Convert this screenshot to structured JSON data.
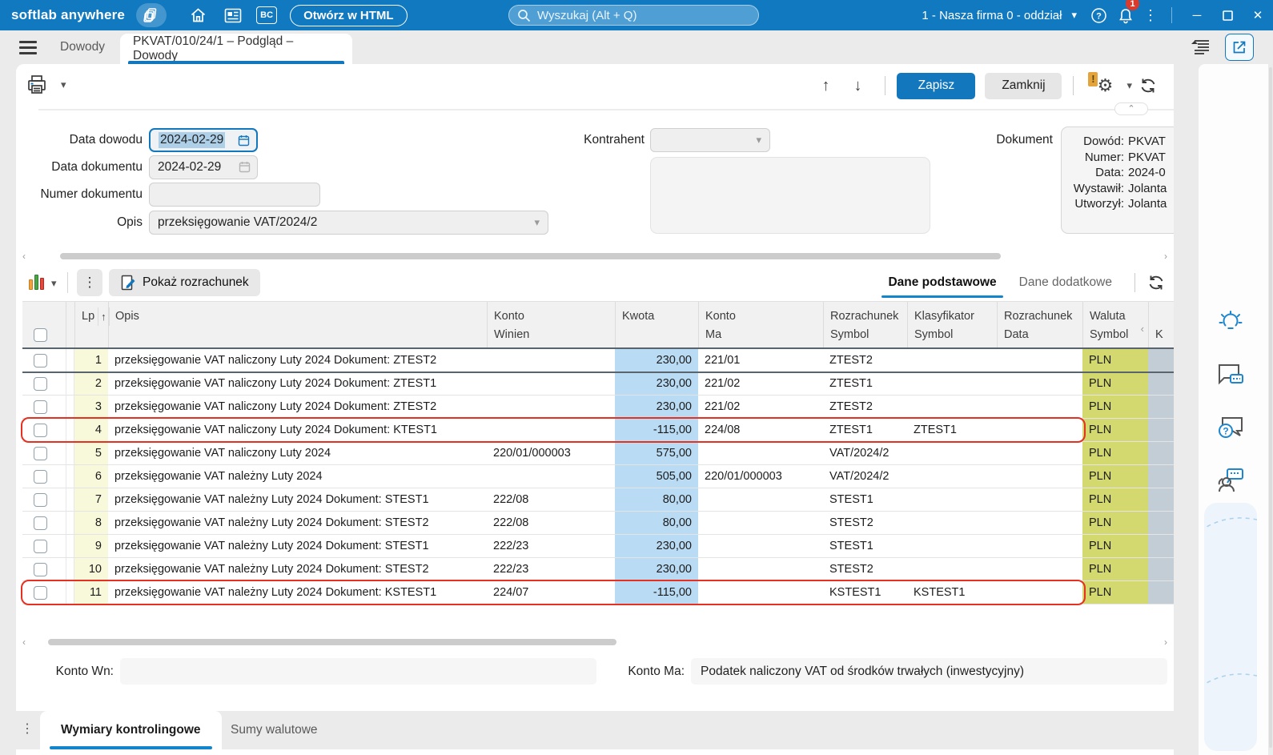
{
  "colors": {
    "topbar_blue": "#1079c0",
    "accent_blue": "#1377bd",
    "badge_red": "#d93a2b",
    "annotation_red": "#e53022",
    "kwota_column_bg": "#b9dbf4",
    "lp_column_bg": "#f8f8da",
    "waluta_column_bg": "#d3d96e"
  },
  "topbar": {
    "app_name": "softlab anywhere",
    "bc_label": "BC",
    "open_html_label": "Otwórz w HTML",
    "search_placeholder": "Wyszukaj (Alt + Q)",
    "company": "1 - Nasza firma 0 - oddział",
    "bell_badge": "1"
  },
  "tabs": {
    "dowody": "Dowody",
    "active": "PKVAT/010/24/1 – Podgląd – Dowody"
  },
  "toolbar": {
    "save": "Zapisz",
    "close": "Zamknij"
  },
  "form": {
    "data_dowodu_label": "Data dowodu",
    "data_dowodu_value": "2024-02-29",
    "data_dokumentu_label": "Data dokumentu",
    "data_dokumentu_value": "2024-02-29",
    "numer_dokumentu_label": "Numer dokumentu",
    "numer_dokumentu_value": "",
    "opis_label": "Opis",
    "opis_value": "przeksięgowanie  VAT/2024/2",
    "kontrahent_label": "Kontrahent",
    "kontrahent_value": "",
    "dokument_label": "Dokument",
    "dokument_lines": [
      {
        "label": "Dowód:",
        "value": "PKVAT"
      },
      {
        "label": "Numer:",
        "value": "PKVAT"
      },
      {
        "label": "Data:",
        "value": "2024-0"
      },
      {
        "label": "Wystawił:",
        "value": "Jolanta"
      },
      {
        "label": "Utworzył:",
        "value": "Jolanta"
      }
    ]
  },
  "grid_toolbar": {
    "pokaz_rozrachunek": "Pokaż rozrachunek",
    "tab_dane_podstawowe": "Dane podstawowe",
    "tab_dane_dodatkowe": "Dane dodatkowe"
  },
  "table": {
    "headers": {
      "lp": "Lp",
      "sort_arrow": "↑",
      "opis": "Opis",
      "konto": "Konto",
      "winien": "Winien",
      "kwota": "Kwota",
      "ma": "Ma",
      "rozrachunek": "Rozrachunek",
      "symbol": "Symbol",
      "klasyfikator": "Klasyfikator",
      "data": "Data",
      "waluta": "Waluta",
      "k": "K"
    },
    "rows": [
      {
        "lp": "1",
        "opis": "przeksięgowanie VAT naliczony Luty 2024 Dokument: ZTEST2",
        "konto_winien": "",
        "kwota": "230,00",
        "konto_ma": "221/01",
        "rozrachunek_symbol": "ZTEST2",
        "klasyfikator_symbol": "",
        "rozrachunek_data": "",
        "waluta": "PLN",
        "selected": true
      },
      {
        "lp": "2",
        "opis": "przeksięgowanie VAT naliczony Luty 2024 Dokument: ZTEST1",
        "konto_winien": "",
        "kwota": "230,00",
        "konto_ma": "221/02",
        "rozrachunek_symbol": "ZTEST1",
        "klasyfikator_symbol": "",
        "rozrachunek_data": "",
        "waluta": "PLN"
      },
      {
        "lp": "3",
        "opis": "przeksięgowanie VAT naliczony Luty 2024 Dokument: ZTEST2",
        "konto_winien": "",
        "kwota": "230,00",
        "konto_ma": "221/02",
        "rozrachunek_symbol": "ZTEST2",
        "klasyfikator_symbol": "",
        "rozrachunek_data": "",
        "waluta": "PLN"
      },
      {
        "lp": "4",
        "opis": "przeksięgowanie VAT naliczony Luty 2024 Dokument: KTEST1",
        "konto_winien": "",
        "kwota": "-115,00",
        "konto_ma": "224/08",
        "rozrachunek_symbol": "ZTEST1",
        "klasyfikator_symbol": "ZTEST1",
        "rozrachunek_data": "",
        "waluta": "PLN",
        "red_outline": true
      },
      {
        "lp": "5",
        "opis": "przeksięgowanie VAT naliczony Luty 2024",
        "konto_winien": "220/01/000003",
        "kwota": "575,00",
        "konto_ma": "",
        "rozrachunek_symbol": "VAT/2024/2",
        "klasyfikator_symbol": "",
        "rozrachunek_data": "",
        "waluta": "PLN"
      },
      {
        "lp": "6",
        "opis": "przeksięgowanie VAT należny Luty 2024",
        "konto_winien": "",
        "kwota": "505,00",
        "konto_ma": "220/01/000003",
        "rozrachunek_symbol": "VAT/2024/2",
        "klasyfikator_symbol": "",
        "rozrachunek_data": "",
        "waluta": "PLN"
      },
      {
        "lp": "7",
        "opis": "przeksięgowanie VAT należny Luty 2024 Dokument: STEST1",
        "konto_winien": "222/08",
        "kwota": "80,00",
        "konto_ma": "",
        "rozrachunek_symbol": "STEST1",
        "klasyfikator_symbol": "",
        "rozrachunek_data": "",
        "waluta": "PLN"
      },
      {
        "lp": "8",
        "opis": "przeksięgowanie VAT należny Luty 2024 Dokument: STEST2",
        "konto_winien": "222/08",
        "kwota": "80,00",
        "konto_ma": "",
        "rozrachunek_symbol": "STEST2",
        "klasyfikator_symbol": "",
        "rozrachunek_data": "",
        "waluta": "PLN"
      },
      {
        "lp": "9",
        "opis": "przeksięgowanie VAT należny Luty 2024 Dokument: STEST1",
        "konto_winien": "222/23",
        "kwota": "230,00",
        "konto_ma": "",
        "rozrachunek_symbol": "STEST1",
        "klasyfikator_symbol": "",
        "rozrachunek_data": "",
        "waluta": "PLN"
      },
      {
        "lp": "10",
        "opis": "przeksięgowanie VAT należny Luty 2024 Dokument: STEST2",
        "konto_winien": "222/23",
        "kwota": "230,00",
        "konto_ma": "",
        "rozrachunek_symbol": "STEST2",
        "klasyfikator_symbol": "",
        "rozrachunek_data": "",
        "waluta": "PLN"
      },
      {
        "lp": "11",
        "opis": "przeksięgowanie VAT należny Luty 2024 Dokument: KSTEST1",
        "konto_winien": "224/07",
        "kwota": "-115,00",
        "konto_ma": "",
        "rozrachunek_symbol": "KSTEST1",
        "klasyfikator_symbol": "KSTEST1",
        "rozrachunek_data": "",
        "waluta": "PLN",
        "red_outline": true
      }
    ]
  },
  "footer": {
    "konto_wn_label": "Konto Wn:",
    "konto_wn_value": "",
    "konto_ma_label": "Konto Ma:",
    "konto_ma_value": "Podatek naliczony VAT od środków trwałych (inwestycyjny)",
    "tab_wymiary": "Wymiary kontrolingowe",
    "tab_sumy": "Sumy walutowe"
  }
}
